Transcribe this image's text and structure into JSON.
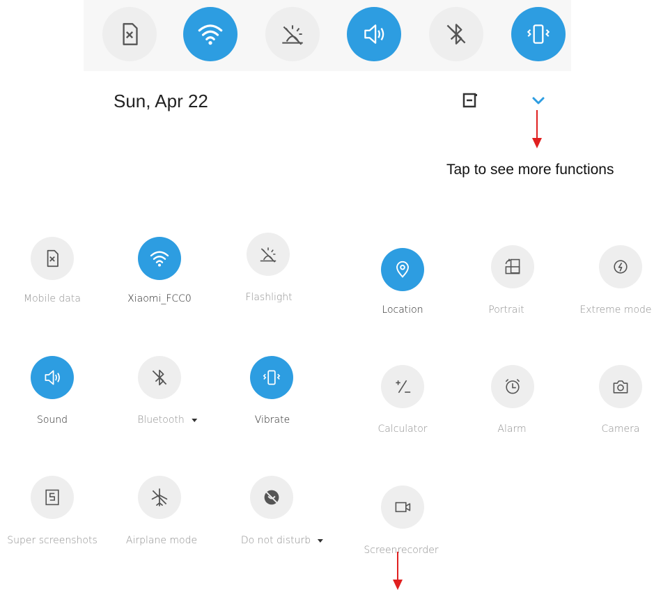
{
  "header": {
    "date": "Sun, Apr 22",
    "callout": "Tap to see more functions",
    "top_toggles": [
      {
        "icon": "sim-off-icon",
        "on": false
      },
      {
        "icon": "wifi-icon",
        "on": true
      },
      {
        "icon": "flashlight-off-icon",
        "on": false
      },
      {
        "icon": "sound-icon",
        "on": true
      },
      {
        "icon": "bluetooth-off-icon",
        "on": false
      },
      {
        "icon": "vibrate-icon",
        "on": true
      }
    ]
  },
  "left_grid": {
    "tiles": [
      {
        "label": "Mobile data",
        "icon": "sim-off-icon",
        "on": false
      },
      {
        "label": "Xiaomi_FCC0",
        "icon": "wifi-icon",
        "on": true
      },
      {
        "label": "Flashlight",
        "icon": "flashlight-off-icon",
        "on": false
      },
      {
        "label": "Sound",
        "icon": "sound-icon",
        "on": true
      },
      {
        "label": "Bluetooth",
        "icon": "bluetooth-off-icon",
        "on": false,
        "dropdown": true
      },
      {
        "label": "Vibrate",
        "icon": "vibrate-icon",
        "on": true
      },
      {
        "label": "Super screenshots",
        "icon": "super-screenshot-icon",
        "on": false
      },
      {
        "label": "Airplane mode",
        "icon": "airplane-off-icon",
        "on": false
      },
      {
        "label": "Do not disturb",
        "icon": "do-not-disturb-icon",
        "on": false,
        "dropdown": true
      }
    ]
  },
  "right_grid": {
    "tiles": [
      {
        "label": "Location",
        "icon": "location-icon",
        "on": true
      },
      {
        "label": "Portrait",
        "icon": "rotation-icon",
        "on": false
      },
      {
        "label": "Extreme mode",
        "icon": "battery-saver-icon",
        "on": false
      },
      {
        "label": "Calculator",
        "icon": "calculator-icon",
        "on": false
      },
      {
        "label": "Alarm",
        "icon": "alarm-icon",
        "on": false
      },
      {
        "label": "Camera",
        "icon": "camera-icon",
        "on": false
      },
      {
        "label": "Screenrecorder",
        "icon": "screen-recorder-icon",
        "on": false
      }
    ]
  },
  "colors": {
    "accent": "#2d9de1",
    "tile_off": "#eeeeee",
    "arrow": "#e02020"
  }
}
